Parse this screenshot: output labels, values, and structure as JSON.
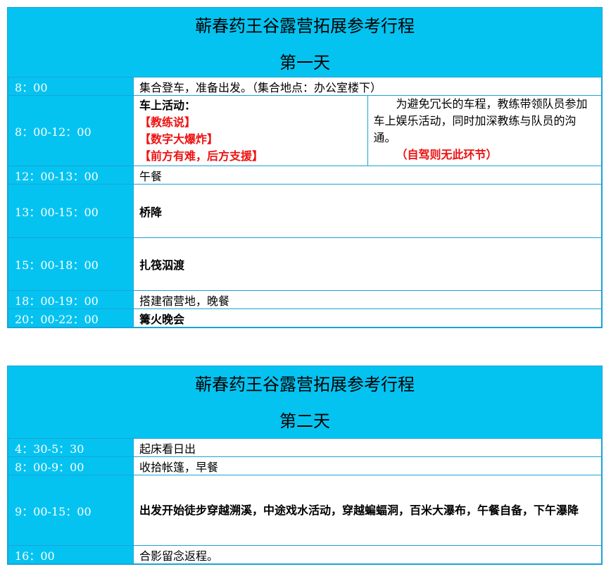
{
  "schedules": [
    {
      "title": "蕲春药王谷露营拓展参考行程",
      "day": "第一天",
      "rows": [
        {
          "time": "8：00",
          "activity": "集合登车，准备出发。（集合地点：办公室楼下）"
        },
        {
          "time": "8：00-12：00",
          "activity_heading": "车上活动：",
          "activity_items": [
            "【教练说】",
            "【数字大爆炸】",
            "【前方有难，后方支援】"
          ],
          "note": "为避免冗长的车程，教练带领队员参加车上娱乐活动，同时加深教练与队员的沟通。",
          "note_red": "（自驾则无此环节）"
        },
        {
          "time": "12：00-13：00",
          "activity": "午餐"
        },
        {
          "time": "13：00-15：00",
          "activity": "桥降"
        },
        {
          "time": "15：00-18：00",
          "activity": "扎筏泅渡"
        },
        {
          "time": "18：00-19：00",
          "activity": "搭建宿营地，晚餐"
        },
        {
          "time": "20：00-22：00",
          "activity": "篝火晚会"
        }
      ]
    },
    {
      "title": "蕲春药王谷露营拓展参考行程",
      "day": "第二天",
      "rows": [
        {
          "time": "4：30-5：30",
          "activity": "起床看日出"
        },
        {
          "time": "8：00-9：00",
          "activity": "收拾帐篷，早餐"
        },
        {
          "time": "9：00-15：00",
          "activity": "出发开始徒步穿越溯溪，中途戏水活动，穿越蝙蝠洞，百米大瀑布，午餐自备，下午瀑降"
        },
        {
          "time": "16：00",
          "activity": "合影留念返程。"
        }
      ]
    }
  ],
  "colors": {
    "header_bg": "#05c3f0",
    "border": "#1aa3d6",
    "highlight": "#ee1111"
  }
}
